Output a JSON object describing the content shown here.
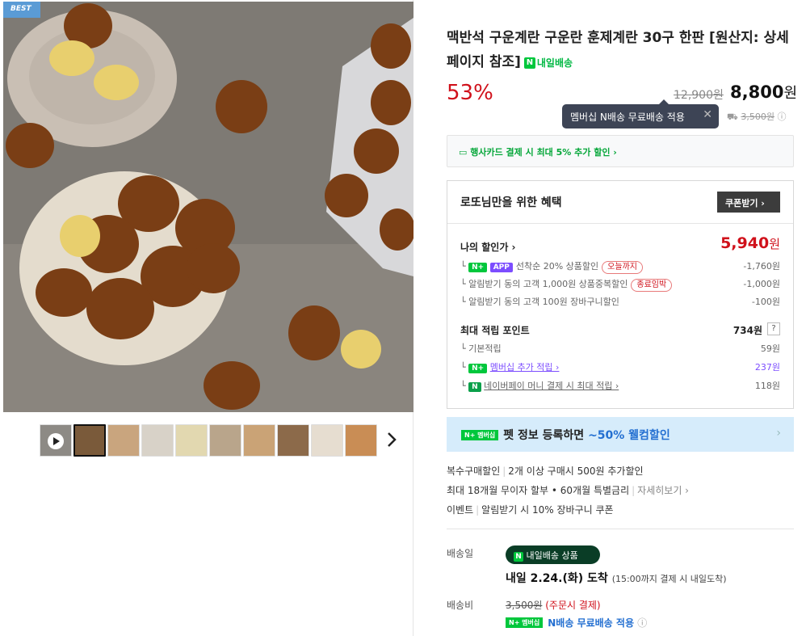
{
  "badge": "BEST",
  "product": {
    "title": "맥반석 구운계란 구운란 훈제계란 30구 한판 [원산지: 상세페이지 참조]",
    "delivery_badge": "내일배송",
    "discount": "53%",
    "original_price": "12,900원",
    "price_num": "8,800",
    "price_unit": "원"
  },
  "tooltip": {
    "text": "멤버십 N배송 무료배송 적용"
  },
  "ship_small": "3,500원",
  "card_promo": "행사카드 결제 시 최대 5% 추가 할인 ›",
  "benefit": {
    "heading": "로또님만을 위한 혜택",
    "coupon_button": "쿠폰받기 ›",
    "my_price_label": "나의 할인가 ›",
    "my_price_num": "5,940",
    "my_price_unit": "원",
    "discounts": [
      {
        "label": "선착순 20% 상품할인",
        "tag": "오늘까지",
        "value": "-1,760원",
        "badge": "N+ APP"
      },
      {
        "label": "알림받기 동의 고객 1,000원 상품중복할인",
        "tag": "종료임박",
        "value": "-1,000원"
      },
      {
        "label": "알림받기 동의 고객 100원 장바구니할인",
        "tag": "",
        "value": "-100원"
      }
    ],
    "points_label": "최대 적립 포인트",
    "points_value": "734원",
    "points_q": "?",
    "points": [
      {
        "label": "기본적립",
        "value": "59원"
      },
      {
        "label": "멤버십 추가 적립 ›",
        "value": "237원"
      },
      {
        "label": "네이버페이 머니 결제 시 최대 적립 ›",
        "value": "118원"
      }
    ]
  },
  "promo_banner": {
    "label_a": "펫 정보 등록하면 ",
    "label_b": "~50% 웰컴할인",
    "mem": "N+ 멤버십"
  },
  "info": {
    "multi": "복수구매할인",
    "multi_desc": "2개 이상 구매시 500원 추가할인",
    "installment": "최대 18개월 무이자 할부 • 60개월 특별금리",
    "detail": "자세히보기 ›",
    "event": "이벤트",
    "event_desc": "알림받기 시 10% 장바구니 쿠폰"
  },
  "delivery": {
    "day_label": "배송일",
    "badge": "내일배송 상품",
    "date": "내일 2.24.(화) 도착",
    "date_note": "(15:00까지 결제 시 내일도착)",
    "fee_label": "배송비",
    "fee": "3,500원",
    "fee_note": "(주문시 결제)",
    "nship": "N배송 무료배송 적용"
  }
}
